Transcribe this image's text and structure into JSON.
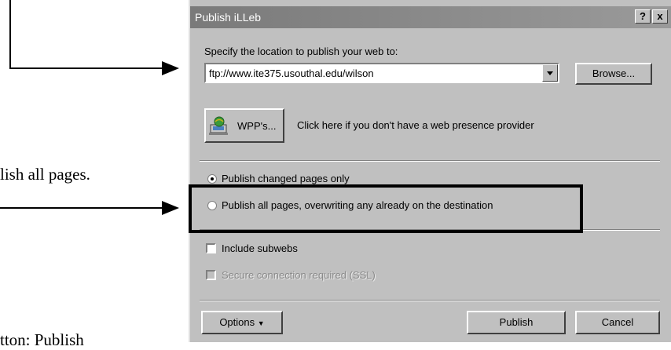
{
  "document": {
    "fragment_pages": "lish all pages.",
    "fragment_button": "tton: Publish"
  },
  "dialog": {
    "title": "Publish iLLeb",
    "help_button": "?",
    "close_button": "x",
    "location_label": "Specify the location to publish your web to:",
    "location_value": "ftp://www.ite375.usouthal.edu/wilson",
    "browse_label": "Browse...",
    "wpp_label": "WPP's...",
    "wpp_hint": "Click here if you don't have a web presence provider",
    "radio_changed": "Publish changed pages only",
    "radio_all": "Publish all pages, overwriting any already on the destination",
    "include_subwebs": "Include subwebs",
    "secure_connection": "Secure connection required (SSL)",
    "options_label": "Options",
    "publish_label": "Publish",
    "cancel_label": "Cancel"
  },
  "icons": {
    "wpp": "globe-computer-icon",
    "dropdown": "chevron-down-icon"
  }
}
